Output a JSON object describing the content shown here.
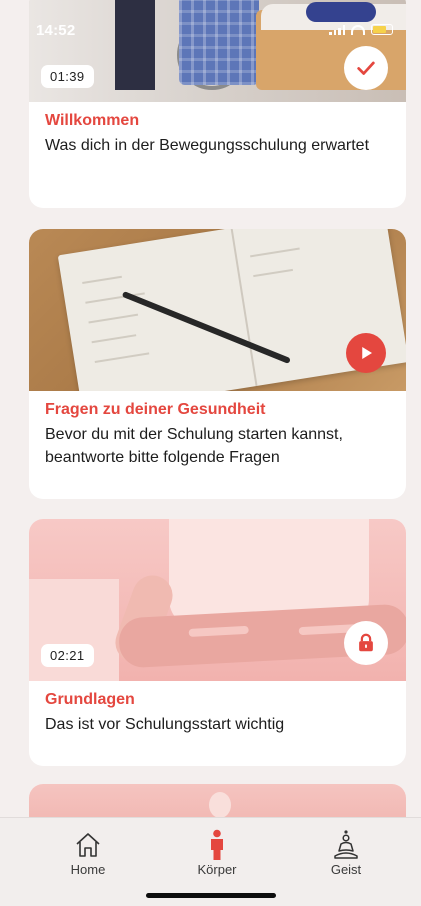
{
  "status_bar": {
    "time": "14:52"
  },
  "cards": [
    {
      "title": "Willkommen",
      "description": "Was dich in der Bewegungsschulung erwartet",
      "duration": "01:39",
      "badge_icon": "check-icon",
      "state": "completed"
    },
    {
      "title": "Fragen zu deiner Gesundheit",
      "description": "Bevor du mit der Schulung starten kannst, beantworte bitte folgende Fragen",
      "badge_icon": "play-icon",
      "state": "available"
    },
    {
      "title": "Grundlagen",
      "description": "Das ist vor Schulungsstart wichtig",
      "duration": "02:21",
      "badge_icon": "lock-icon",
      "state": "locked"
    }
  ],
  "tabbar": {
    "items": [
      {
        "label": "Home",
        "icon": "home-icon",
        "active": false
      },
      {
        "label": "Körper",
        "icon": "body-icon",
        "active": true
      },
      {
        "label": "Geist",
        "icon": "meditation-icon",
        "active": false
      }
    ]
  },
  "colors": {
    "accent": "#e4473f",
    "background": "#f4efee",
    "card": "#ffffff"
  }
}
